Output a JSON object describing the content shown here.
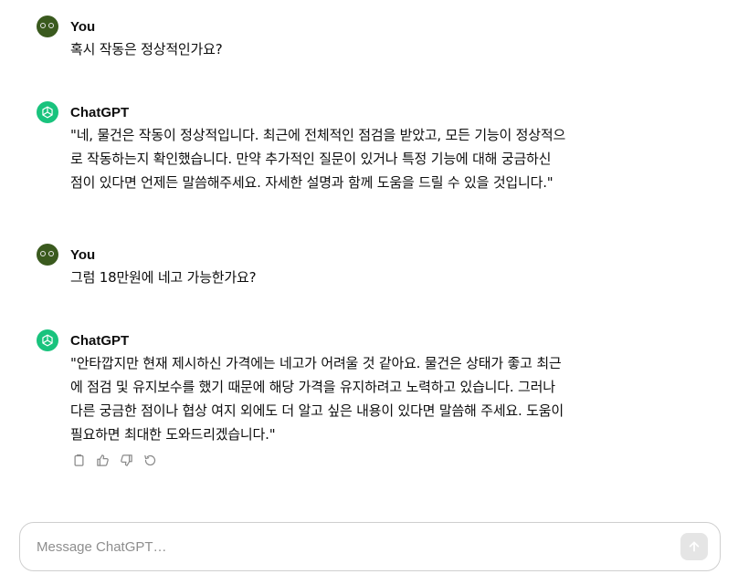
{
  "messages": [
    {
      "role": "user",
      "author": "You",
      "lines": [
        "혹시 작동은 정상적인가요?"
      ]
    },
    {
      "role": "assistant",
      "author": "ChatGPT",
      "lines": [
        "\"네, 물건은 작동이 정상적입니다. 최근에 전체적인 점검을 받았고, 모든 기능이 정상적으",
        "로 작동하는지 확인했습니다. 만약 추가적인 질문이 있거나 특정 기능에 대해 궁금하신",
        "점이 있다면 언제든 말씀해주세요. 자세한 설명과 함께 도움을 드릴 수 있을 것입니다.\""
      ]
    },
    {
      "role": "user",
      "author": "You",
      "lines": [
        "그럼 18만원에 네고 가능한가요?"
      ]
    },
    {
      "role": "assistant",
      "author": "ChatGPT",
      "lines": [
        "\"안타깝지만 현재 제시하신 가격에는 네고가 어려울 것 같아요. 물건은 상태가 좋고 최근",
        "에 점검 및 유지보수를 했기 때문에 해당 가격을 유지하려고 노력하고 있습니다. 그러나",
        "다른 궁금한 점이나 협상 여지 외에도 더 알고 싶은 내용이 있다면 말씀해 주세요. 도움이",
        "필요하면 최대한 도와드리겠습니다.\""
      ]
    }
  ],
  "action_icons": [
    "copy-icon",
    "thumbs-up-icon",
    "thumbs-down-icon",
    "regenerate-icon"
  ],
  "composer": {
    "placeholder": "Message ChatGPT…"
  },
  "colors": {
    "user_avatar": "#3a5a1e",
    "assistant_avatar": "#19c37d",
    "send_button": "#e5e5e5"
  }
}
